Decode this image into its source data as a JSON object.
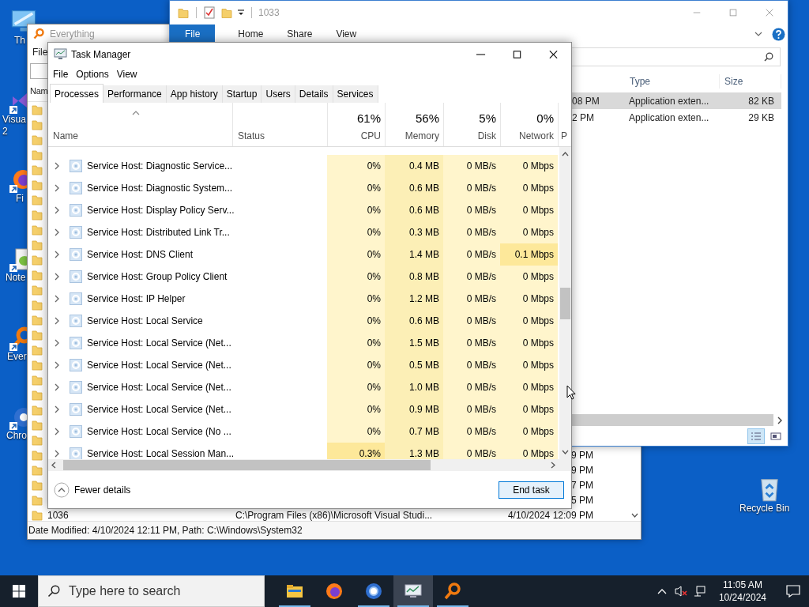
{
  "desktop_icons": [
    {
      "kind": "monitor",
      "lines": [
        "Th"
      ]
    },
    {
      "kind": "vs",
      "lines": [
        "Visua",
        "2"
      ]
    },
    {
      "kind": "firefox",
      "lines": [
        "Fi"
      ]
    },
    {
      "kind": "notepad",
      "lines": [
        "Note"
      ]
    },
    {
      "kind": "everything",
      "lines": [
        "Ever"
      ]
    },
    {
      "kind": "chrome",
      "lines": [
        "Chro"
      ]
    },
    {
      "kind": "recycle",
      "lines": [
        "Recycle Bin"
      ]
    }
  ],
  "everything": {
    "title": "Everything",
    "menu": [
      "File"
    ],
    "column": "Nam",
    "rows": [
      {
        "kind": "folder"
      },
      {
        "kind": "folder"
      },
      {
        "kind": "folder"
      },
      {
        "kind": "folder"
      },
      {
        "kind": "folder"
      },
      {
        "kind": "folder"
      },
      {
        "kind": "folder"
      },
      {
        "kind": "folder"
      },
      {
        "kind": "folder"
      },
      {
        "kind": "folder"
      },
      {
        "kind": "folder"
      },
      {
        "kind": "folder"
      },
      {
        "kind": "folder"
      },
      {
        "kind": "folder"
      },
      {
        "kind": "folder"
      },
      {
        "kind": "folder"
      },
      {
        "kind": "folder"
      },
      {
        "kind": "folder"
      },
      {
        "kind": "folder"
      },
      {
        "kind": "folder"
      },
      {
        "kind": "folder"
      },
      {
        "kind": "folder"
      },
      {
        "kind": "folder"
      },
      {
        "kind": "folder",
        "modified": "9 PM"
      },
      {
        "kind": "folder",
        "modified": "9 PM"
      },
      {
        "kind": "folder",
        "modified": "7 PM"
      },
      {
        "kind": "folder",
        "modified": "5 PM"
      },
      {
        "kind": "folder",
        "name": "1036",
        "path": "C:\\Program Files (x86)\\Microsoft Visual Studi...",
        "modified": "4/10/2024 12:09 PM"
      }
    ],
    "status_bar": "Date Modified: 4/10/2024 12:11 PM, Path: C:\\Windows\\System32"
  },
  "explorer": {
    "title": "1033",
    "ribbon_tabs": [
      {
        "label": "File",
        "selected": true
      },
      {
        "label": "Home",
        "selected": false
      },
      {
        "label": "Share",
        "selected": false
      },
      {
        "label": "View",
        "selected": false
      }
    ],
    "columns": [
      "Type",
      "Size"
    ],
    "rows": [
      {
        "modified": "08 PM",
        "type": "Application exten...",
        "size": "82 KB",
        "selected": true
      },
      {
        "modified": "2 PM",
        "type": "Application exten...",
        "size": "29 KB",
        "selected": false
      }
    ]
  },
  "task_manager": {
    "title": "Task Manager",
    "menu": [
      "File",
      "Options",
      "View"
    ],
    "tabs": [
      {
        "label": "Processes",
        "selected": true
      },
      {
        "label": "Performance",
        "selected": false
      },
      {
        "label": "App history",
        "selected": false
      },
      {
        "label": "Startup",
        "selected": false
      },
      {
        "label": "Users",
        "selected": false
      },
      {
        "label": "Details",
        "selected": false
      },
      {
        "label": "Services",
        "selected": false
      }
    ],
    "columns": [
      {
        "label": "Name"
      },
      {
        "label": "Status"
      },
      {
        "percent": "61%",
        "label": "CPU"
      },
      {
        "percent": "56%",
        "label": "Memory"
      },
      {
        "percent": "5%",
        "label": "Disk"
      },
      {
        "percent": "0%",
        "label": "Network"
      },
      {
        "label": "P"
      }
    ],
    "rows": [
      {
        "name": "Service Host: Diagnostic Service...",
        "cpu": "0%",
        "memory": "0.4 MB",
        "disk": "0 MB/s",
        "network": "0 Mbps"
      },
      {
        "name": "Service Host: Diagnostic System...",
        "cpu": "0%",
        "memory": "0.6 MB",
        "disk": "0 MB/s",
        "network": "0 Mbps"
      },
      {
        "name": "Service Host: Display Policy Serv...",
        "cpu": "0%",
        "memory": "0.6 MB",
        "disk": "0 MB/s",
        "network": "0 Mbps"
      },
      {
        "name": "Service Host: Distributed Link Tr...",
        "cpu": "0%",
        "memory": "0.3 MB",
        "disk": "0 MB/s",
        "network": "0 Mbps"
      },
      {
        "name": "Service Host: DNS Client",
        "cpu": "0%",
        "memory": "1.4 MB",
        "disk": "0 MB/s",
        "network": "0.1 Mbps",
        "network_high": true
      },
      {
        "name": "Service Host: Group Policy Client",
        "cpu": "0%",
        "memory": "0.8 MB",
        "disk": "0 MB/s",
        "network": "0 Mbps"
      },
      {
        "name": "Service Host: IP Helper",
        "cpu": "0%",
        "memory": "1.2 MB",
        "disk": "0 MB/s",
        "network": "0 Mbps"
      },
      {
        "name": "Service Host: Local Service",
        "cpu": "0%",
        "memory": "0.6 MB",
        "disk": "0 MB/s",
        "network": "0 Mbps"
      },
      {
        "name": "Service Host: Local Service (Net...",
        "cpu": "0%",
        "memory": "1.5 MB",
        "disk": "0 MB/s",
        "network": "0 Mbps"
      },
      {
        "name": "Service Host: Local Service (Net...",
        "cpu": "0%",
        "memory": "0.5 MB",
        "disk": "0 MB/s",
        "network": "0 Mbps"
      },
      {
        "name": "Service Host: Local Service (Net...",
        "cpu": "0%",
        "memory": "1.0 MB",
        "disk": "0 MB/s",
        "network": "0 Mbps"
      },
      {
        "name": "Service Host: Local Service (Net...",
        "cpu": "0%",
        "memory": "0.9 MB",
        "disk": "0 MB/s",
        "network": "0 Mbps"
      },
      {
        "name": "Service Host: Local Service (No ...",
        "cpu": "0%",
        "memory": "0.7 MB",
        "disk": "0 MB/s",
        "network": "0 Mbps"
      },
      {
        "name": "Service Host: Local Session Man...",
        "cpu": "0.3%",
        "memory": "1.3 MB",
        "disk": "0 MB/s",
        "network": "0 Mbps",
        "cpu_high": true
      }
    ],
    "fewer_details": "Fewer details",
    "end_task": "End task"
  },
  "taskbar": {
    "search": {
      "placeholder": "Type here to search"
    },
    "apps": [
      {
        "kind": "explorer",
        "running": true,
        "active": false
      },
      {
        "kind": "firefox",
        "running": false,
        "active": false
      },
      {
        "kind": "chrome",
        "running": true,
        "active": false
      },
      {
        "kind": "taskmanager",
        "running": true,
        "active": true
      },
      {
        "kind": "everything",
        "running": true,
        "active": false
      }
    ],
    "time": "11:05 AM",
    "date": "10/24/2024"
  }
}
